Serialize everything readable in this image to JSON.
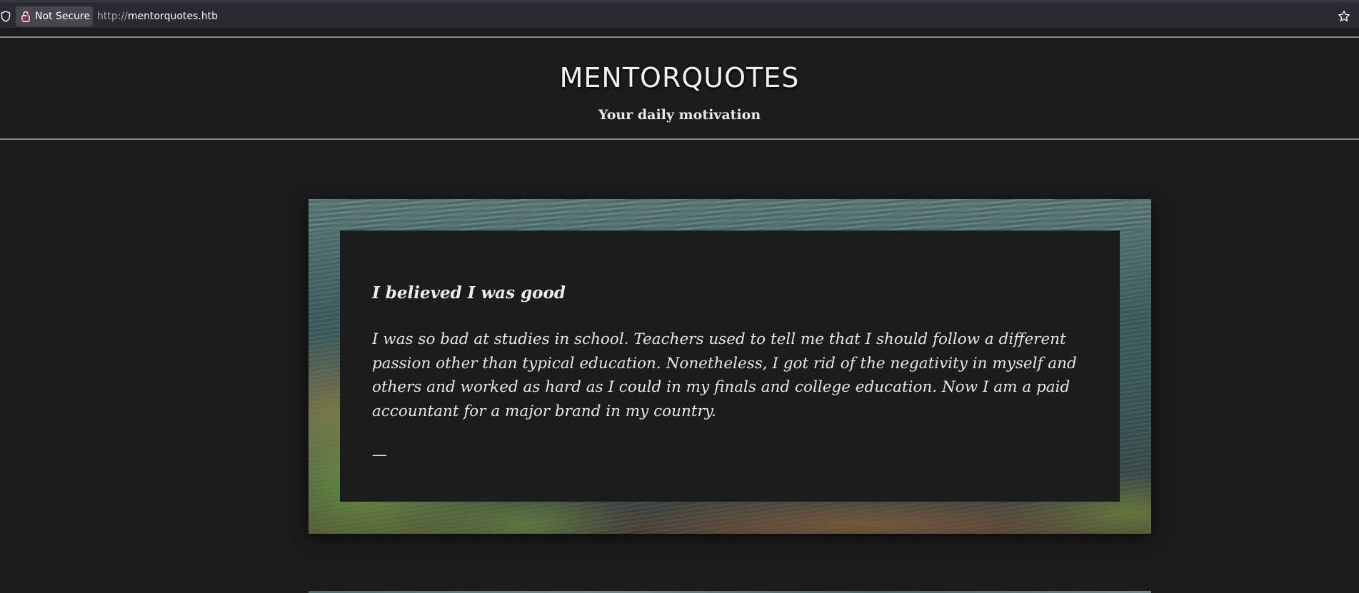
{
  "browser": {
    "security_label": "Not Secure",
    "url_scheme": "http://",
    "url_host": "mentorquotes.htb",
    "icons": [
      "shield-icon",
      "lock-icon",
      "star-icon"
    ]
  },
  "header": {
    "title": "MENTORQUOTES",
    "tagline": "Your daily motivation"
  },
  "quote": {
    "title": "I believed I was good",
    "body": "I was so bad at studies in school. Teachers used to tell me that I should follow a different passion other than typical education. Nonetheless, I got rid of the negativity in myself and others and worked as hard as I could in my finals and college education. Now I am a paid accountant for a major brand in my country.",
    "author": "—"
  },
  "colors": {
    "page_background": "#1b1c1e",
    "chrome_background": "#2b2a33",
    "text": "#e6e6e6"
  }
}
